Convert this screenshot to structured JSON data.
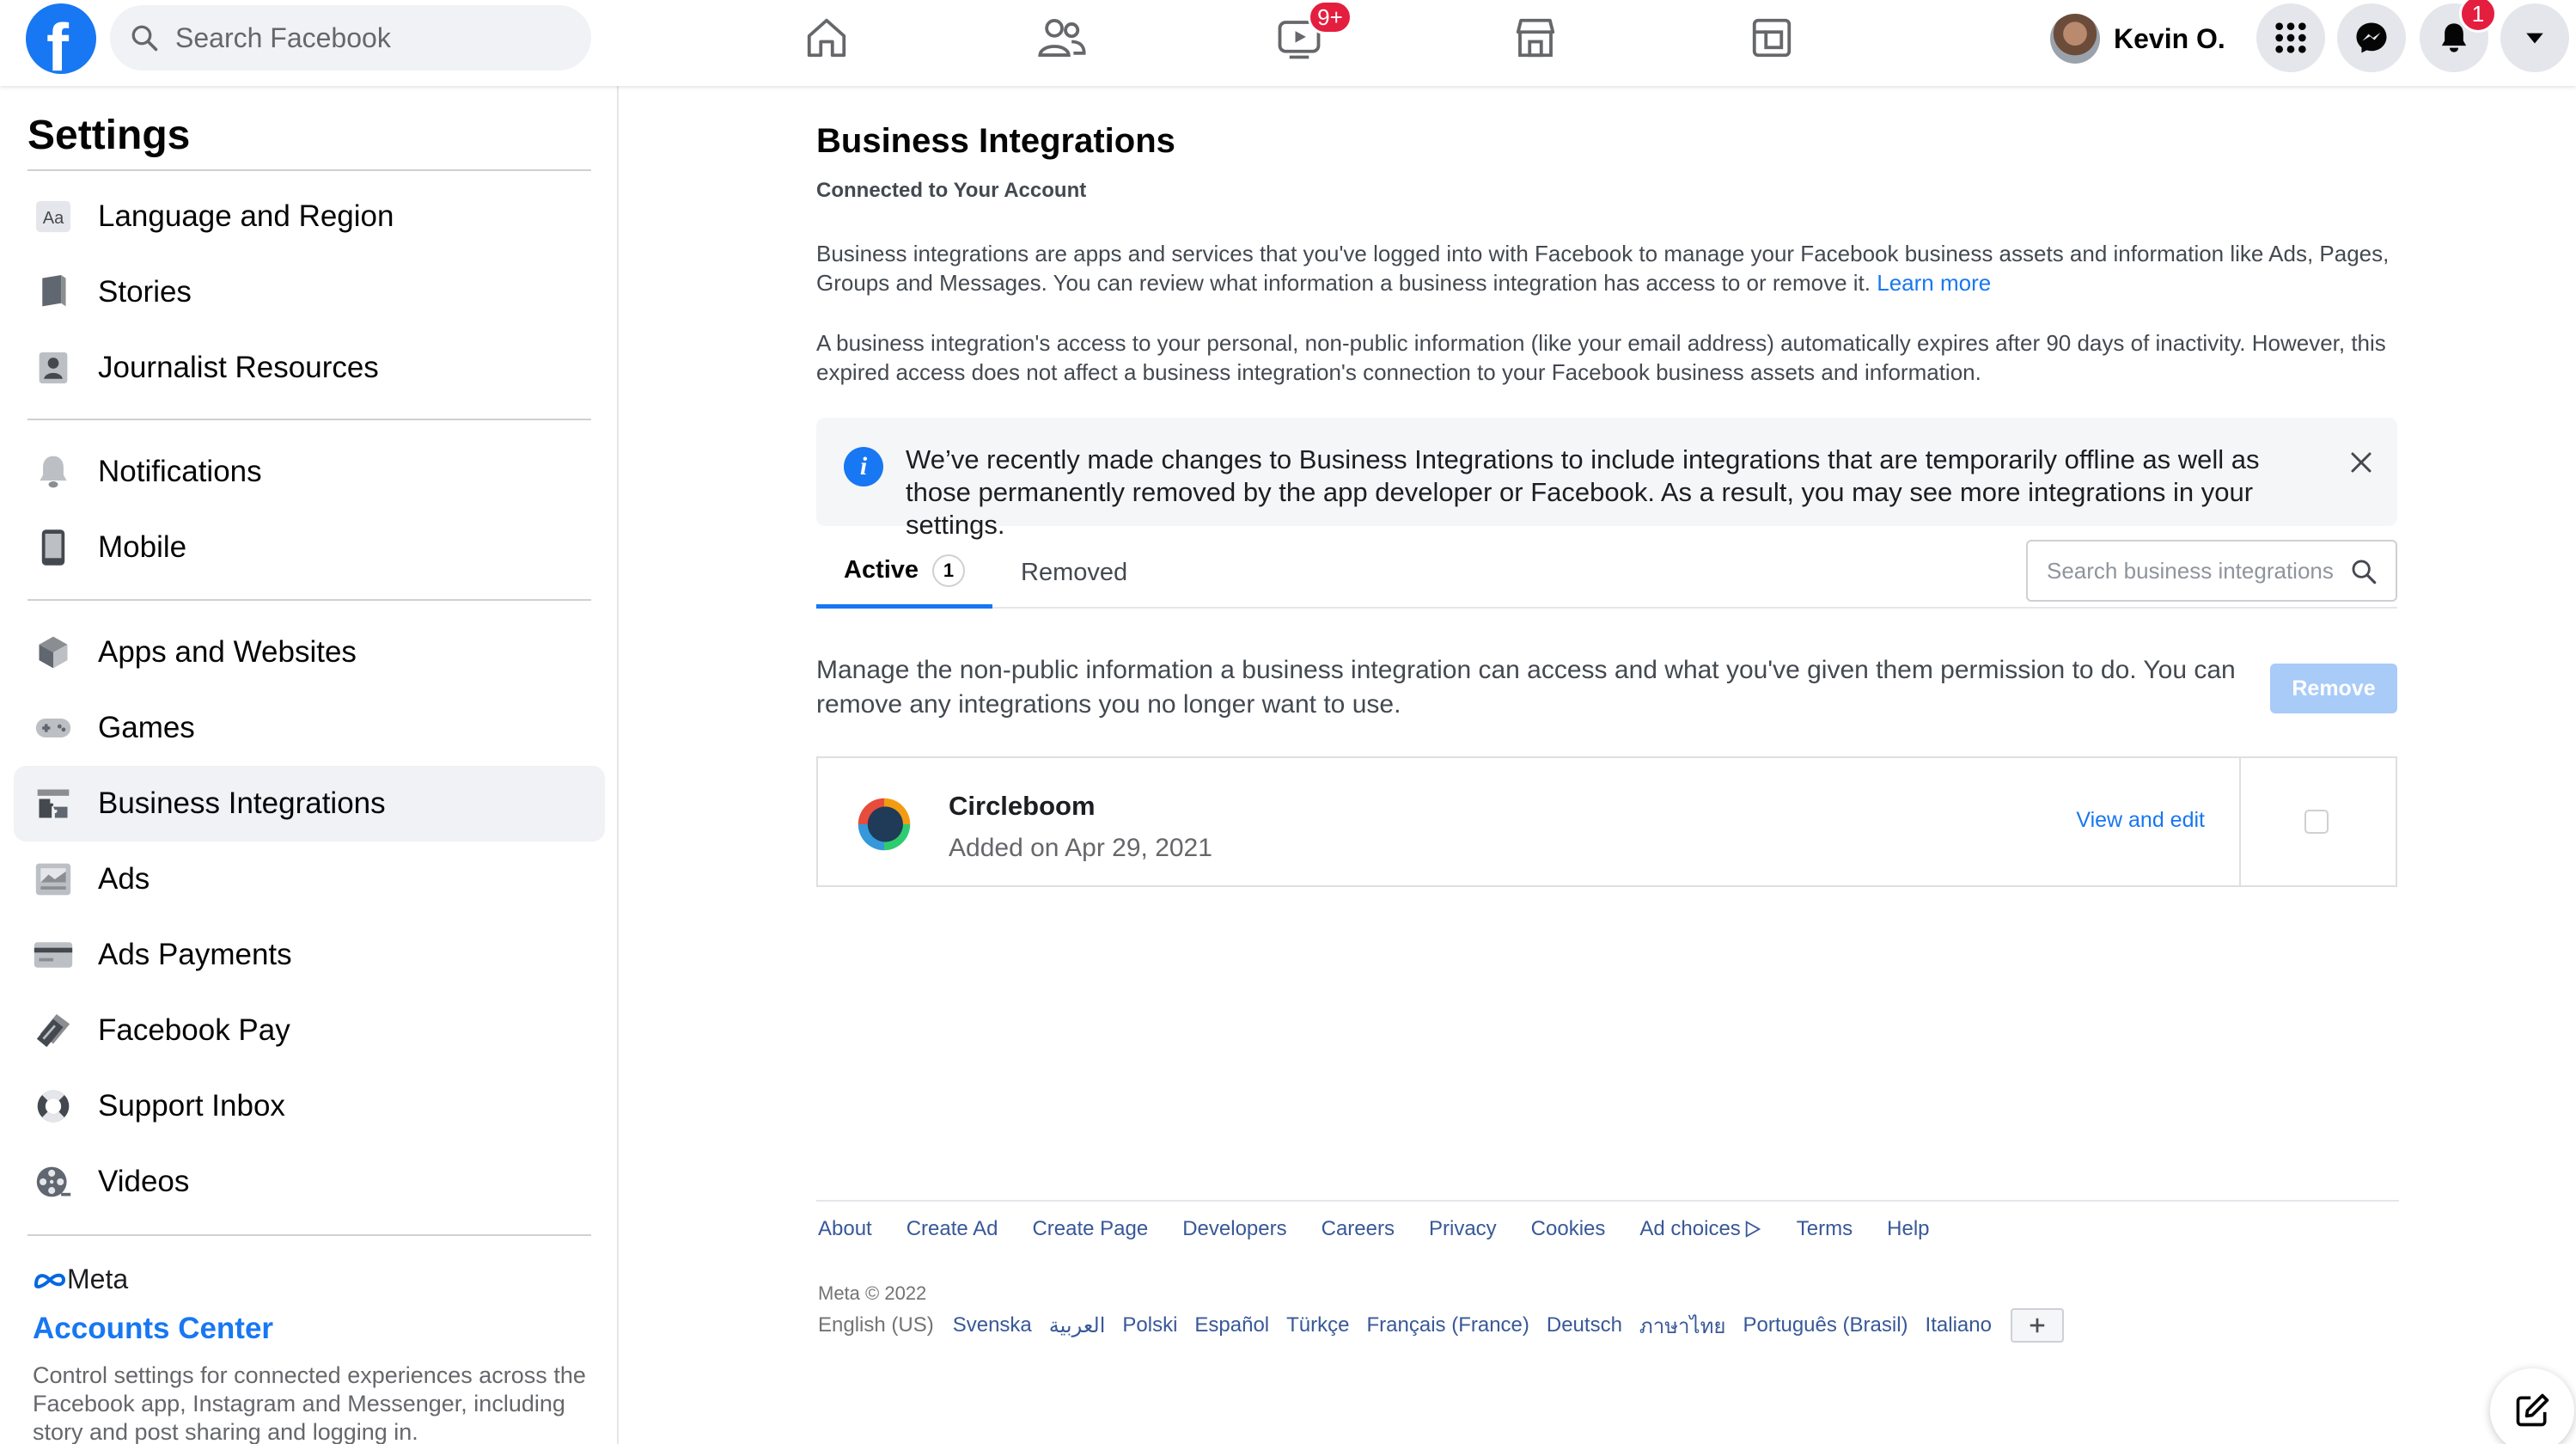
{
  "header": {
    "search_placeholder": "Search Facebook",
    "watch_badge": "9+",
    "profile_name": "Kevin O.",
    "notifications_badge": "1"
  },
  "sidebar": {
    "title": "Settings",
    "groups": [
      [
        {
          "label": "Language and Region",
          "icon": "language-icon"
        },
        {
          "label": "Stories",
          "icon": "book-icon"
        },
        {
          "label": "Journalist Resources",
          "icon": "id-card-icon"
        }
      ],
      [
        {
          "label": "Notifications",
          "icon": "bell-icon"
        },
        {
          "label": "Mobile",
          "icon": "mobile-phone-icon"
        }
      ],
      [
        {
          "label": "Apps and Websites",
          "icon": "cube-icon"
        },
        {
          "label": "Games",
          "icon": "gamepad-icon"
        },
        {
          "label": "Business Integrations",
          "icon": "puzzle-icon",
          "active": true
        },
        {
          "label": "Ads",
          "icon": "ads-icon"
        },
        {
          "label": "Ads Payments",
          "icon": "credit-card-icon"
        },
        {
          "label": "Facebook Pay",
          "icon": "pay-icon"
        },
        {
          "label": "Support Inbox",
          "icon": "lifebuoy-icon"
        },
        {
          "label": "Videos",
          "icon": "film-reel-icon"
        }
      ]
    ],
    "meta_label": "Meta",
    "accounts_center": "Accounts Center",
    "accounts_desc": "Control settings for connected experiences across the Facebook app, Instagram and Messenger, including story and post sharing and logging in."
  },
  "main": {
    "title": "Business Integrations",
    "subtitle": "Connected to Your Account",
    "para1": "Business integrations are apps and services that you've logged into with Facebook to manage your Facebook business assets and information like Ads, Pages, Groups and Messages. You can review what information a business integration has access to or remove it.",
    "learn_more": "Learn more",
    "para2": "A business integration's access to your personal, non-public information (like your email address) automatically expires after 90 days of inactivity. However, this expired access does not affect a business integration's connection to your Facebook business assets and information.",
    "banner": "We’ve recently made changes to Business Integrations to include integrations that are temporarily offline as well as those permanently removed by the app developer or Facebook. As a result, you may see more integrations in your settings.",
    "tabs": [
      {
        "label": "Active",
        "count": "1"
      },
      {
        "label": "Removed"
      }
    ],
    "search_placeholder": "Search business integrations",
    "manage_text": "Manage the non-public information a business integration can access and what you've given them permission to do. You can remove any integrations you no longer want to use.",
    "remove_label": "Remove",
    "integration": {
      "name": "Circleboom",
      "added": "Added on Apr 29, 2021",
      "action": "View and edit"
    }
  },
  "footer": {
    "links": [
      "About",
      "Create Ad",
      "Create Page",
      "Developers",
      "Careers",
      "Privacy",
      "Cookies",
      "Ad choices",
      "Terms",
      "Help"
    ],
    "copyright": "Meta © 2022",
    "current_language": "English (US)",
    "languages": [
      "Svenska",
      "العربية",
      "Polski",
      "Español",
      "Türkçe",
      "Français (France)",
      "Deutsch",
      "ภาษาไทย",
      "Português (Brasil)",
      "Italiano"
    ]
  },
  "colors": {
    "brand": "#1877f2",
    "badge": "#e41e3f",
    "active_bg": "#f0f2f5"
  }
}
